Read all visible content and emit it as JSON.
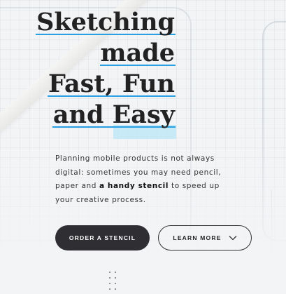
{
  "hero": {
    "headline": [
      "Sketching",
      "made",
      "Fast, Fun",
      "and Easy"
    ],
    "description": {
      "before": "Planning mobile products is not always digital: sometimes you may need pencil, paper and ",
      "bold": "a handy stencil",
      "after": " to speed up your creative process."
    },
    "primary_button": "ORDER A STENCIL",
    "secondary_button": "LEARN MORE"
  },
  "colors": {
    "accent": "#2aa0e4",
    "highlight": "#bfe8f6",
    "primary_button_bg": "#2f2f33",
    "text": "#222222"
  },
  "icons": {
    "learn_more": "chevron-down-icon",
    "scroll": "dot-grid-icon"
  }
}
